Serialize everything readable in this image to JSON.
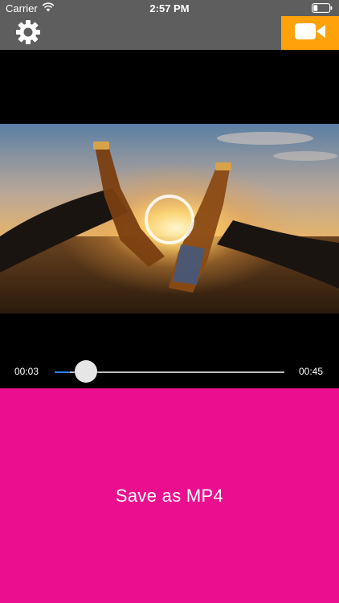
{
  "status_bar": {
    "carrier": "Carrier",
    "time": "2:57 PM",
    "wifi_icon": "wifi-icon",
    "battery_icon": "battery-icon"
  },
  "toolbar": {
    "settings_icon": "gear-icon",
    "record_icon": "video-camera-icon",
    "record_color": "#fea20c"
  },
  "player": {
    "current_time": "00:03",
    "total_time": "00:45",
    "progress": 0.067,
    "play_icon": "play-ring-icon",
    "track_fill_color": "#2f7ff5"
  },
  "actions": {
    "save_label": "Save as MP4",
    "save_color": "#eb0f8f"
  }
}
